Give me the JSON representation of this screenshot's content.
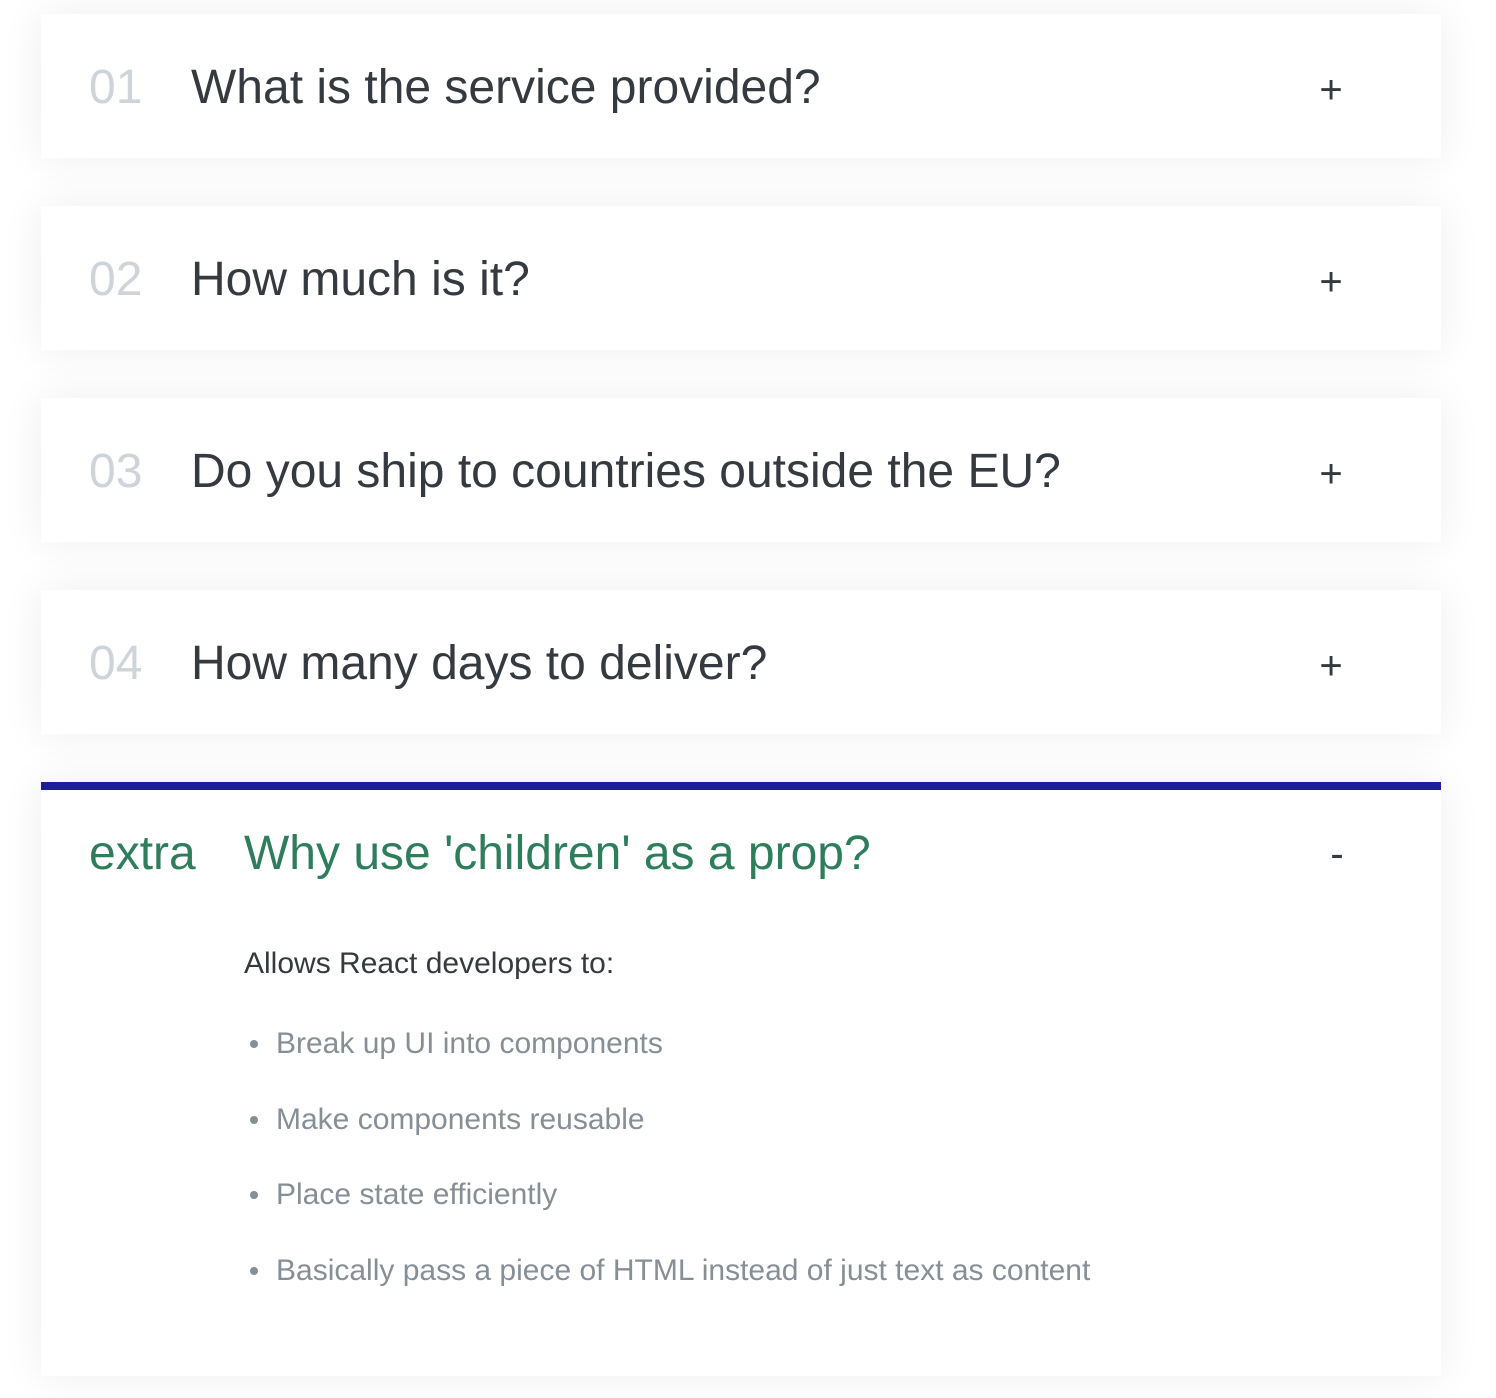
{
  "faq": {
    "items": [
      {
        "num": "01",
        "title": "What is the service provided?",
        "toggle": "+"
      },
      {
        "num": "02",
        "title": "How much is it?",
        "toggle": "+"
      },
      {
        "num": "03",
        "title": "Do you ship to countries outside the EU?",
        "toggle": "+"
      },
      {
        "num": "04",
        "title": "How many days to deliver?",
        "toggle": "+"
      }
    ],
    "open_item": {
      "num": "extra",
      "title": "Why use 'children' as a prop?",
      "toggle": "-",
      "intro": "Allows React developers to:",
      "points": [
        "Break up UI into components",
        "Make components reusable",
        "Place state efficiently",
        "Basically pass a piece of HTML instead of just text as content"
      ]
    }
  },
  "colors": {
    "accent_border": "#1c1e9e",
    "open_text": "#2e7d5b",
    "number_muted": "#ced4da",
    "title_text": "#343a40",
    "list_text": "#868e96"
  }
}
